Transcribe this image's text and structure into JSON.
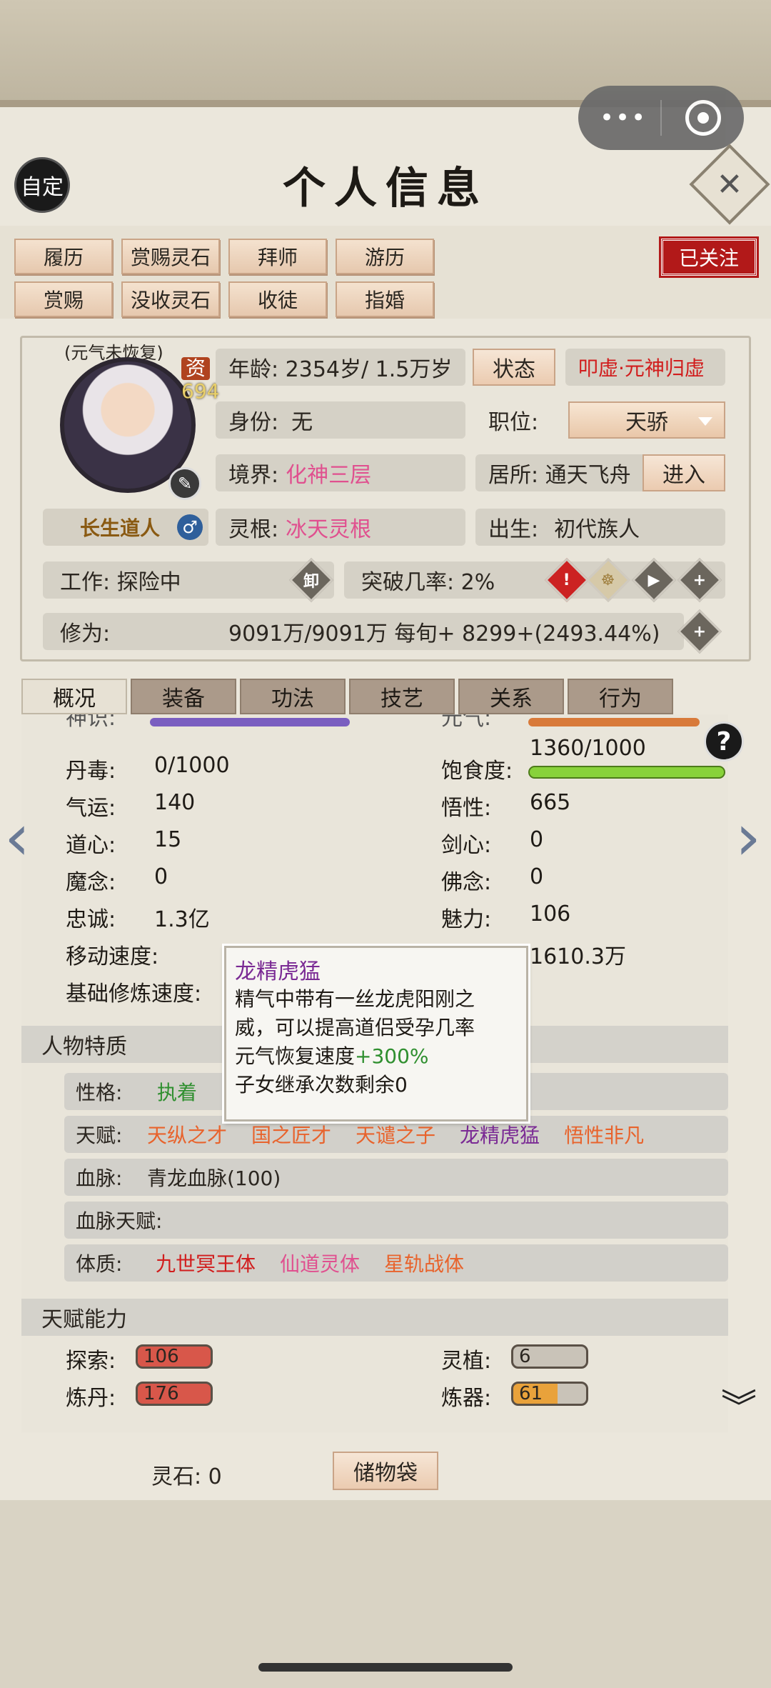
{
  "capsule": {
    "dots": "•••"
  },
  "header": {
    "custom_label": "自定",
    "title": "个人信息",
    "close_symbol": "✕"
  },
  "actions": {
    "row1": [
      "履历",
      "赏赐灵石",
      "拜师",
      "游历"
    ],
    "row2": [
      "赏赐",
      "没收灵石",
      "收徒",
      "指婚"
    ],
    "follow_label": "已关注"
  },
  "profile": {
    "restore_note": "(元气未恢复)",
    "aptitude_label": "资",
    "aptitude_value": "694",
    "name": "长生道人",
    "gender_symbol": "♂",
    "age_text": "年龄: 2354岁/ 1.5万岁",
    "state_btn": "状态",
    "state_value": "叩虚·元神归虚",
    "identity_label": "身份:",
    "identity_value": "无",
    "position_label": "职位:",
    "position_value": "天骄",
    "realm_label": "境界:",
    "realm_value": "化神三层",
    "residence_text": "居所: 通天飞舟",
    "enter_btn": "进入",
    "root_label": "灵根:",
    "root_value": "冰天灵根",
    "birth_label": "出生:",
    "birth_value": "初代族人",
    "work_text": "工作: 探险中",
    "unload_icon": "卸",
    "break_text": "突破几率:  2%",
    "cult_label": "修为:",
    "cult_value": "9091万/9091万  每旬+  8299+(2493.44%)"
  },
  "tabs": [
    "概况",
    "装备",
    "功法",
    "技艺",
    "关系",
    "行为"
  ],
  "stats": {
    "partial_left": "神识:",
    "partial_right": "元气:",
    "food_value": "1360/1000",
    "rows": [
      {
        "l": "丹毒:",
        "lv": "0/1000",
        "r": "饱食度:",
        "rv": ""
      },
      {
        "l": "气运:",
        "lv": "140",
        "r": "悟性:",
        "rv": "665"
      },
      {
        "l": "道心:",
        "lv": "15",
        "r": "剑心:",
        "rv": "0"
      },
      {
        "l": "魔念:",
        "lv": "0",
        "r": "佛念:",
        "rv": "0"
      },
      {
        "l": "忠诚:",
        "lv": "1.3亿",
        "r": "魅力:",
        "rv": "106"
      },
      {
        "l": "移动速度:",
        "lv": "",
        "r": "",
        "rv": "1610.3万"
      },
      {
        "l": "基础修炼速度:",
        "lv": "",
        "r": "",
        "rv": ""
      }
    ]
  },
  "traits": {
    "section": "人物特质",
    "personality_label": "性格:",
    "personality_value": "执着",
    "talent_label": "天赋:",
    "talents": [
      "天纵之才",
      "国之匠才",
      "天谴之子",
      "龙精虎猛",
      "悟性非凡"
    ],
    "blood_label": "血脉:",
    "blood_value": "青龙血脉(100)",
    "blood_talent_label": "血脉天赋:",
    "body_label": "体质:",
    "bodies": [
      "九世冥王体",
      "仙道灵体",
      "星轨战体"
    ]
  },
  "abilities": {
    "section": "天赋能力",
    "items": [
      {
        "label": "探索:",
        "value": "106",
        "fill": 1.0,
        "color": "#d8574a"
      },
      {
        "label": "灵植:",
        "value": "6",
        "fill": 0.06,
        "color": "#c9c3b8"
      },
      {
        "label": "炼丹:",
        "value": "176",
        "fill": 1.0,
        "color": "#d8574a"
      },
      {
        "label": "炼器:",
        "value": "61",
        "fill": 0.61,
        "color": "#e9a23b"
      }
    ]
  },
  "tooltip": {
    "title": "龙精虎猛",
    "line1": "精气中带有一丝龙虎阳刚之",
    "line2": "威，可以提高道侣受孕几率",
    "line3_prefix": "元气恢复速度",
    "line3_value": "+300%",
    "line4": "子女继承次数剩余0"
  },
  "footer": {
    "stones_text": "灵石:  0",
    "bag_label": "储物袋"
  },
  "colors": {
    "red": "#d11d1d",
    "pink": "#e0508f",
    "orange": "#e8632c",
    "purple": "#7a2a94",
    "green": "#2f8f2f"
  }
}
